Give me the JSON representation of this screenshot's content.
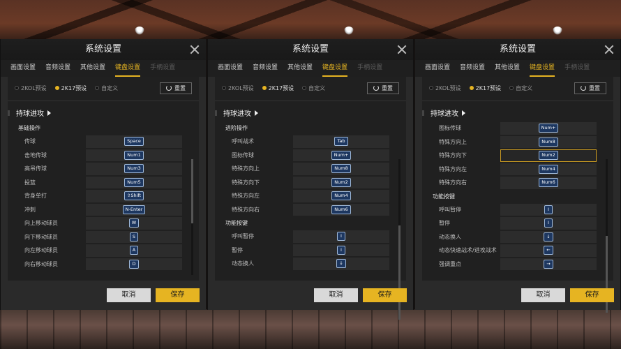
{
  "panels": [
    {
      "title": "系统设置",
      "tabs": [
        "画面设置",
        "音频设置",
        "其他设置",
        "键盘设置",
        "手柄设置"
      ],
      "presets": [
        "2KOL预设",
        "2K17预设",
        "自定义"
      ],
      "selected_preset": 1,
      "reset_label": "重置",
      "section_title": "持球进攻",
      "groups": [
        {
          "header": "基础操作",
          "rows": [
            {
              "label": "传球",
              "key": "Space"
            },
            {
              "label": "击地传球",
              "key": "Num1"
            },
            {
              "label": "高吊传球",
              "key": "Num3"
            },
            {
              "label": "投篮",
              "key": "Num5"
            },
            {
              "label": "背身单打",
              "key": "⇧Shift"
            },
            {
              "label": "冲刺",
              "key": "N-Enter"
            },
            {
              "label": "向上移动球员",
              "key": "W"
            },
            {
              "label": "向下移动球员",
              "key": "S"
            },
            {
              "label": "向左移动球员",
              "key": "A"
            },
            {
              "label": "向右移动球员",
              "key": "D"
            }
          ]
        }
      ],
      "cancel_label": "取消",
      "save_label": "保存"
    },
    {
      "title": "系统设置",
      "tabs": [
        "画面设置",
        "音频设置",
        "其他设置",
        "键盘设置",
        "手柄设置"
      ],
      "presets": [
        "2KOL预设",
        "2K17预设",
        "自定义"
      ],
      "selected_preset": 1,
      "reset_label": "重置",
      "section_title": "持球进攻",
      "groups": [
        {
          "header": "进阶操作",
          "rows": [
            {
              "label": "呼叫战术",
              "key": "Tab"
            },
            {
              "label": "图标传球",
              "key": "Num+"
            },
            {
              "label": "特殊方向上",
              "key": "Num8"
            },
            {
              "label": "特殊方向下",
              "key": "Num2"
            },
            {
              "label": "特殊方向左",
              "key": "Num4"
            },
            {
              "label": "特殊方向右",
              "key": "Num6"
            }
          ]
        },
        {
          "header": "功能按键",
          "rows": [
            {
              "label": "呼叫暂停",
              "key": "I"
            },
            {
              "label": "暂停",
              "key": "I"
            },
            {
              "label": "动态换人",
              "key": "↓"
            }
          ]
        }
      ],
      "cancel_label": "取消",
      "save_label": "保存"
    },
    {
      "title": "系统设置",
      "tabs": [
        "画面设置",
        "音频设置",
        "其他设置",
        "键盘设置",
        "手柄设置"
      ],
      "presets": [
        "2KOL预设",
        "2K17预设",
        "自定义"
      ],
      "selected_preset": 1,
      "reset_label": "重置",
      "section_title": "持球进攻",
      "groups": [
        {
          "header": "",
          "rows": [
            {
              "label": "图标传球",
              "key": "Num+"
            },
            {
              "label": "特殊方向上",
              "key": "Num8"
            },
            {
              "label": "特殊方向下",
              "key": "Num2",
              "highlight": true
            },
            {
              "label": "特殊方向左",
              "key": "Num4"
            },
            {
              "label": "特殊方向右",
              "key": "Num6"
            }
          ]
        },
        {
          "header": "功能按键",
          "rows": [
            {
              "label": "呼叫暂停",
              "key": "I"
            },
            {
              "label": "暂停",
              "key": "I"
            },
            {
              "label": "动态换人",
              "key": "↓"
            },
            {
              "label": "动态快速战术/进攻战术",
              "key": "←"
            },
            {
              "label": "强调重点",
              "key": "→"
            }
          ]
        }
      ],
      "cancel_label": "取消",
      "save_label": "保存"
    }
  ],
  "colors": {
    "accent": "#e6b422",
    "panel_bg": "#2a2a2a",
    "keycap_bg": "#1d3760"
  }
}
